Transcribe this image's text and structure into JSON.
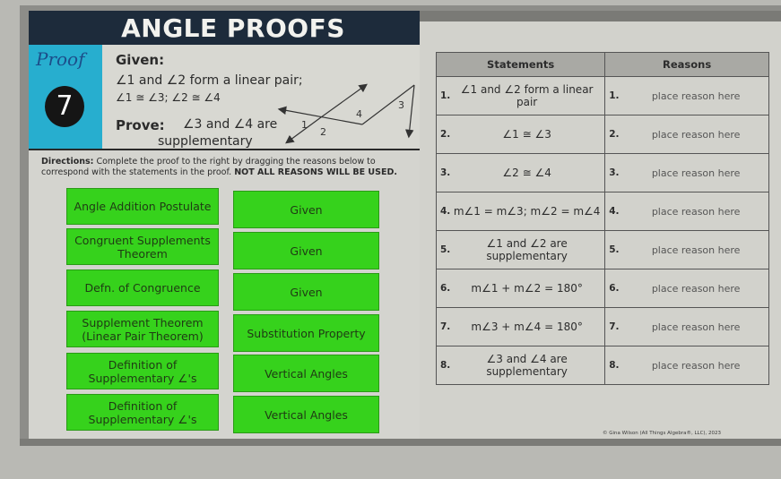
{
  "title": "ANGLE PROOFS",
  "badge": {
    "script": "Proof",
    "number": "7"
  },
  "given": {
    "label": "Given:",
    "line1": "∠1 and ∠2 form a linear pair;",
    "line2": "∠1 ≅ ∠3; ∠2 ≅ ∠4"
  },
  "prove": {
    "label": "Prove:",
    "line1": "∠3 and ∠4 are",
    "line2": "supplementary"
  },
  "diagram_labels": [
    "1",
    "2",
    "3",
    "4"
  ],
  "directions": {
    "prefix": "Directions:",
    "text": " Complete the proof to the right by dragging the reasons below to correspond with the statements in the proof. ",
    "emphasis": "NOT ALL REASONS WILL BE USED."
  },
  "reason_cards": [
    "Angle Addition Postulate",
    "Given",
    "Congruent Supplements Theorem",
    "Given",
    "Defn. of Congruence",
    "Given",
    "Supplement Theorem (Linear Pair Theorem)",
    "Substitution Property",
    "Definition of Supplementary ∠'s",
    "Vertical Angles",
    "Definition of Supplementary ∠'s",
    "Vertical Angles"
  ],
  "table": {
    "headers": {
      "statements": "Statements",
      "reasons": "Reasons"
    },
    "rows": [
      {
        "num": "1.",
        "statement": "∠1 and ∠2 form a linear pair",
        "reason": "place reason here"
      },
      {
        "num": "2.",
        "statement": "∠1 ≅ ∠3",
        "reason": "place reason here"
      },
      {
        "num": "3.",
        "statement": "∠2 ≅ ∠4",
        "reason": "place reason here"
      },
      {
        "num": "4.",
        "statement": "m∠1 = m∠3; m∠2 = m∠4",
        "reason": "place reason here"
      },
      {
        "num": "5.",
        "statement": "∠1 and ∠2 are supplementary",
        "reason": "place reason here"
      },
      {
        "num": "6.",
        "statement": "m∠1 + m∠2 = 180°",
        "reason": "place reason here"
      },
      {
        "num": "7.",
        "statement": "m∠3 + m∠4 = 180°",
        "reason": "place reason here"
      },
      {
        "num": "8.",
        "statement": "∠3 and ∠4 are supplementary",
        "reason": "place reason here"
      }
    ]
  },
  "copyright": "© Gina Wilson (All Things Algebra®, LLC), 2023",
  "colors": {
    "title_bg": "#1d2b3b",
    "badge_bg": "#27aecf",
    "card_green": "#36d21c"
  }
}
